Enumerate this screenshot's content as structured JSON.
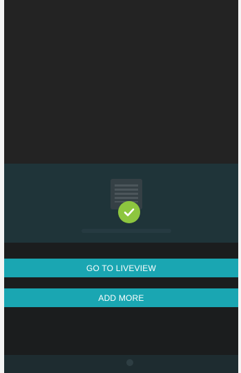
{
  "dialog": {
    "success_icon": "checkmark-icon",
    "device_icon": "camera-device-icon"
  },
  "actions": {
    "liveview_label": "GO TO LIVEVIEW",
    "add_more_label": "ADD MORE"
  },
  "background_text": "",
  "colors": {
    "accent": "#1aa6b2",
    "success": "#8dc63f",
    "background": "#222324",
    "band": "#1f3439"
  }
}
